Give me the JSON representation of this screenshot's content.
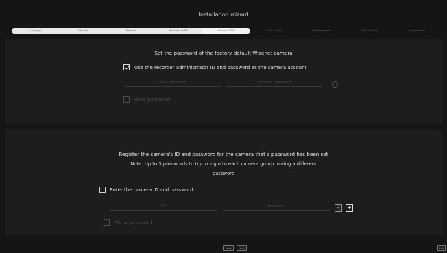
{
  "window": {
    "title": "Installation wizard"
  },
  "steps": [
    {
      "label": "Language",
      "state": "done"
    },
    {
      "label": "Storage",
      "state": "done"
    },
    {
      "label": "Network",
      "state": "done"
    },
    {
      "label": "Recorder ID/PW",
      "state": "done"
    },
    {
      "label": "Camera ID/PW",
      "state": "active"
    },
    {
      "label": "Date & Time",
      "state": "todo"
    },
    {
      "label": "Camera register",
      "state": "todo"
    },
    {
      "label": "Channel setup",
      "state": "todo"
    },
    {
      "label": "Easy connect",
      "state": "todo"
    }
  ],
  "section1": {
    "heading": "Set the password of the factory default Wisenet camera",
    "use_recorder_label": "Use the recorder administrator ID and password as the camera account",
    "use_recorder_checked": true,
    "new_password_placeholder": "New password",
    "confirm_password_placeholder": "Confirm password",
    "info_glyph": "i",
    "show_password_label": "Show password"
  },
  "section2": {
    "heading": "Register the camera's ID and password for the camera that a password has been set",
    "note_line1": "Note: Up to 3 passwords to try to login to each camera group having a different",
    "note_line2": "password",
    "enter_id_label": "Enter the camera ID and password",
    "enter_id_checked": false,
    "id_placeholder": "ID",
    "password_placeholder": "Password",
    "minus_label": "-",
    "plus_label": "+",
    "show_password_label": "Show password"
  },
  "footer": {
    "back_label": "Back",
    "next_label": "Next",
    "exit_label": "Exit"
  }
}
